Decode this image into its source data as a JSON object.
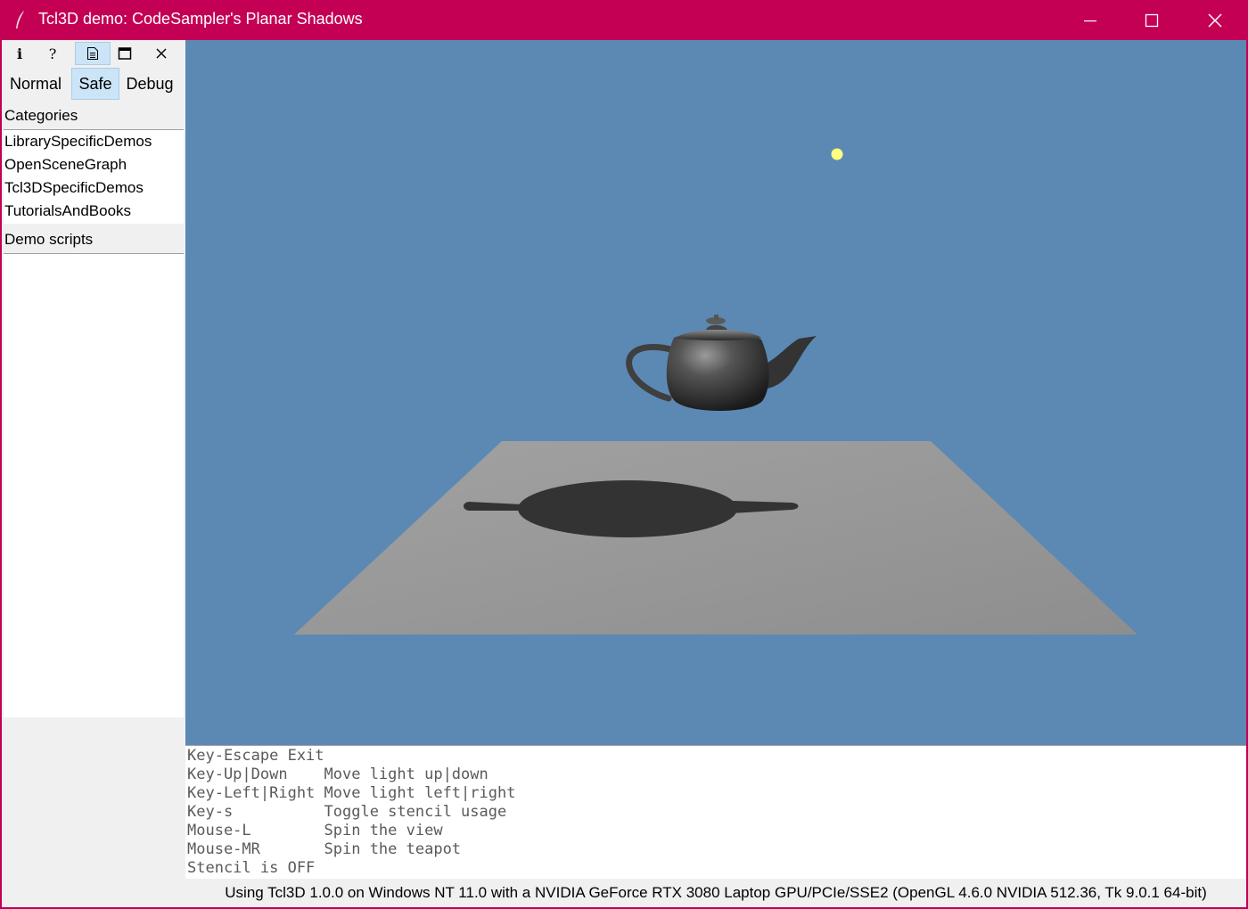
{
  "window": {
    "title": "Tcl3D demo: CodeSampler's Planar Shadows",
    "accent_color": "#c40055",
    "controls": [
      "minimize-icon",
      "maximize-icon",
      "close-icon"
    ]
  },
  "toolbar": {
    "buttons": [
      {
        "name": "info",
        "glyph": "i"
      },
      {
        "name": "help",
        "glyph": "?"
      },
      {
        "name": "source",
        "glyph": "source-file-icon",
        "selected": true
      },
      {
        "name": "fullscreen",
        "glyph": "window-icon"
      },
      {
        "name": "exit",
        "glyph": "×"
      }
    ]
  },
  "modes": {
    "items": [
      "Normal",
      "Safe",
      "Debug"
    ],
    "selected": "Safe"
  },
  "categories": {
    "label": "Categories",
    "items": [
      "LibrarySpecificDemos",
      "OpenSceneGraph",
      "Tcl3DSpecificDemos",
      "TutorialsAndBooks"
    ]
  },
  "scripts": {
    "label": "Demo scripts",
    "items": []
  },
  "scene": {
    "background_color": "#5b89b4",
    "light_color": "#ffff80",
    "floor_color": "#9a9a9a",
    "shadow_color": "#333333",
    "teapot_color": "#3a3a3a"
  },
  "console": {
    "lines": [
      "Key-Escape Exit",
      "Key-Up|Down    Move light up|down",
      "Key-Left|Right Move light left|right",
      "Key-s          Toggle stencil usage",
      "Mouse-L        Spin the view",
      "Mouse-MR       Spin the teapot",
      "Stencil is OFF"
    ]
  },
  "status": {
    "text": "Using Tcl3D 1.0.0 on Windows NT 11.0 with a NVIDIA GeForce RTX 3080 Laptop GPU/PCIe/SSE2 (OpenGL 4.6.0 NVIDIA 512.36, Tk 9.0.1 64-bit)"
  }
}
